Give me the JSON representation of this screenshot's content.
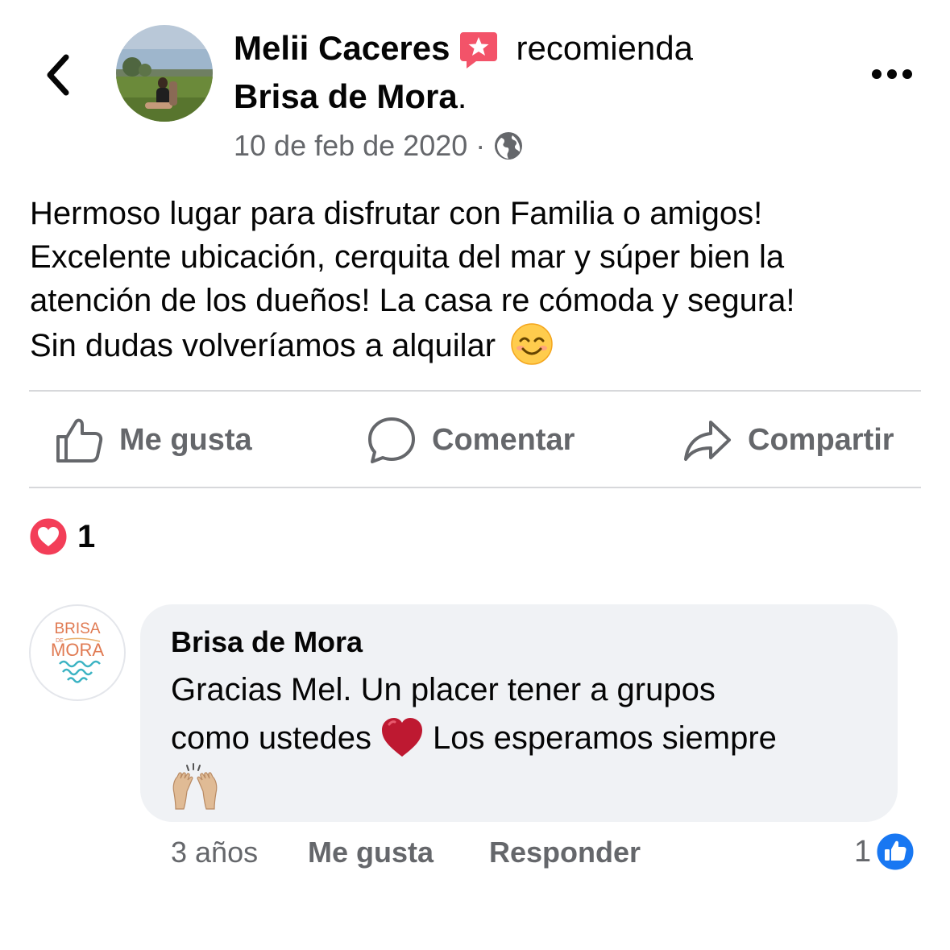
{
  "header": {
    "back_icon": "chevron-left-icon",
    "author_name": "Melii Caceres",
    "recommend_badge_icon": "recommend-star-icon",
    "recommend_word": "recomienda",
    "page_name": "Brisa de Mora",
    "page_suffix": ".",
    "timestamp": "10 de feb de 2020",
    "separator": "·",
    "privacy_icon": "globe-icon",
    "more_icon": "more-dots-icon"
  },
  "post": {
    "text": "Hermoso lugar para disfrutar con Familia o amigos!\nExcelente ubicación, cerquita del mar y súper bien la\natención de los dueños! La casa re cómoda y segura!\nSin dudas volveríamos a alquilar",
    "emoji": "smiling-face-emoji"
  },
  "actions": {
    "like_label": "Me gusta",
    "comment_label": "Comentar",
    "share_label": "Compartir"
  },
  "reactions": {
    "icon": "love-reaction-icon",
    "count": "1"
  },
  "comment": {
    "author": "Brisa de Mora",
    "avatar_logo": {
      "line1": "BRISA",
      "line2": "DE",
      "line3": "MORA"
    },
    "text_part1": "Gracias Mel. Un placer tener a grupos",
    "text_part2": "como ustedes",
    "text_part3": "Los esperamos siempre",
    "time": "3 años",
    "like_label": "Me gusta",
    "reply_label": "Responder",
    "like_count": "1"
  },
  "colors": {
    "secondary_text": "#65676b",
    "bubble_bg": "#f0f2f5",
    "divider": "#d7d8db",
    "facebook_blue": "#1877f2",
    "love_red": "#f33e58",
    "recommend_pink": "#f35369"
  }
}
